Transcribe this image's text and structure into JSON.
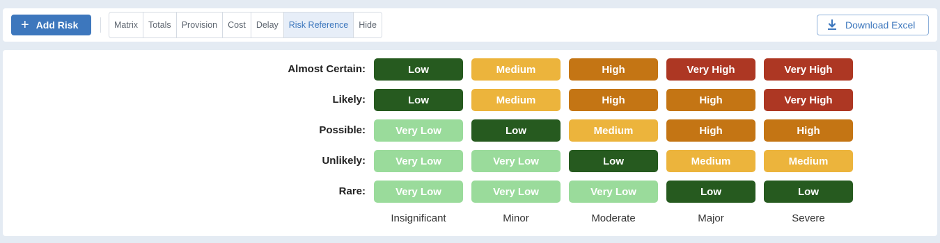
{
  "toolbar": {
    "add_label": "Add Risk",
    "tabs": [
      "Matrix",
      "Totals",
      "Provision",
      "Cost",
      "Delay",
      "Risk Reference",
      "Hide"
    ],
    "active_tab": "Risk Reference",
    "download_label": "Download Excel"
  },
  "matrix": {
    "rows": [
      "Almost Certain:",
      "Likely:",
      "Possible:",
      "Unlikely:",
      "Rare:"
    ],
    "columns": [
      "Insignificant",
      "Minor",
      "Moderate",
      "Major",
      "Severe"
    ],
    "cells": [
      [
        "Low",
        "Medium",
        "High",
        "Very High",
        "Very High"
      ],
      [
        "Low",
        "Medium",
        "High",
        "High",
        "Very High"
      ],
      [
        "Very Low",
        "Low",
        "Medium",
        "High",
        "High"
      ],
      [
        "Very Low",
        "Very Low",
        "Low",
        "Medium",
        "Medium"
      ],
      [
        "Very Low",
        "Very Low",
        "Very Low",
        "Low",
        "Low"
      ]
    ]
  },
  "colors": {
    "Very Low": "#9adb9b",
    "Low": "#265a1f",
    "Medium": "#ecb43c",
    "High": "#c47514",
    "Very High": "#ad3723",
    "accent": "#3d77bd"
  }
}
